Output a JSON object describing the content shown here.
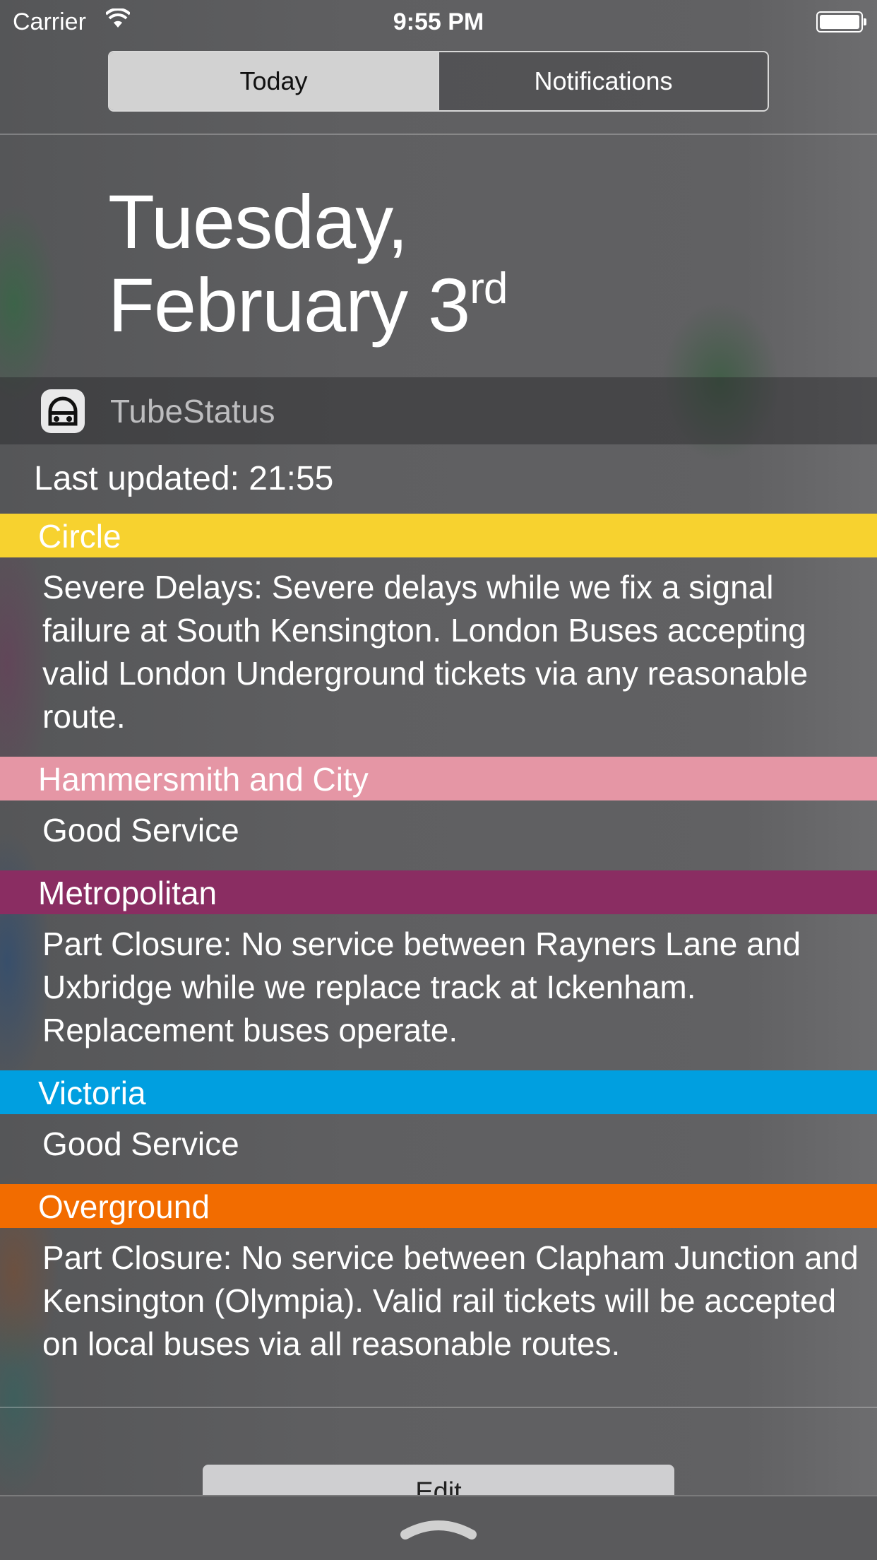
{
  "status_bar": {
    "carrier": "Carrier",
    "time": "9:55 PM"
  },
  "segmented": {
    "today": "Today",
    "notifications": "Notifications"
  },
  "date": {
    "line1": "Tuesday,",
    "line2": "February 3",
    "suffix": "rd"
  },
  "widget": {
    "app_name": "TubeStatus",
    "last_updated": "Last updated: 21:55",
    "lines": [
      {
        "name": "Circle",
        "color": "#f7d22f",
        "status": "Severe Delays: Severe delays while we fix a signal failure at South Kensington. London Buses accepting valid London Underground tickets via any reasonable route."
      },
      {
        "name": "Hammersmith and City",
        "color": "#e596a5",
        "status": "Good Service"
      },
      {
        "name": "Metropolitan",
        "color": "#8a2d62",
        "status": "Part Closure: No service between Rayners Lane and Uxbridge while we replace track at Ickenham. Replacement buses operate."
      },
      {
        "name": "Victoria",
        "color": "#009fe0",
        "status": "Good Service"
      },
      {
        "name": "Overground",
        "color": "#f26c00",
        "status": "Part Closure: No service between Clapham Junction and Kensington (Olympia). Valid rail tickets will be accepted on local buses via all reasonable routes."
      }
    ]
  },
  "edit_label": "Edit",
  "battery": {
    "level": 1.0
  }
}
